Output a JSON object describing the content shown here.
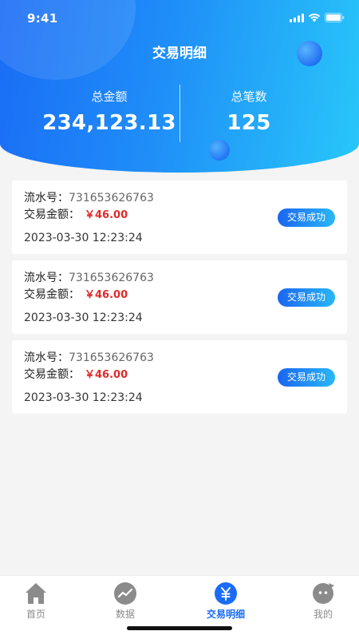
{
  "status_bar": {
    "time": "9:41"
  },
  "header": {
    "title": "交易明细",
    "total_amount_label": "总金额",
    "total_amount_value": "234,123.13",
    "total_count_label": "总笔数",
    "total_count_value": "125"
  },
  "colors": {
    "brand_blue": "#1a6cf6",
    "accent_cyan": "#28c7f9",
    "amount_red": "#e12a2a"
  },
  "transactions": [
    {
      "serial_label": "流水号：",
      "serial": "731653626763",
      "amount_label": "交易金额：",
      "amount": "￥46.00",
      "datetime": "2023-03-30   12:23:24",
      "status": "交易成功"
    },
    {
      "serial_label": "流水号：",
      "serial": "731653626763",
      "amount_label": "交易金额：",
      "amount": "￥46.00",
      "datetime": "2023-03-30   12:23:24",
      "status": "交易成功"
    },
    {
      "serial_label": "流水号：",
      "serial": "731653626763",
      "amount_label": "交易金额：",
      "amount": "￥46.00",
      "datetime": "2023-03-30   12:23:24",
      "status": "交易成功"
    }
  ],
  "tabbar": {
    "items": [
      {
        "label": "首页",
        "icon": "home-icon"
      },
      {
        "label": "数据",
        "icon": "chart-icon"
      },
      {
        "label": "交易明细",
        "icon": "yuan-icon",
        "active": true
      },
      {
        "label": "我的",
        "icon": "profile-icon"
      }
    ]
  }
}
